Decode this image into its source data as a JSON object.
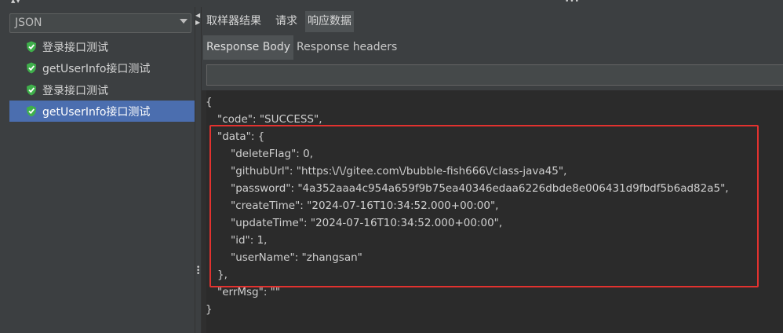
{
  "left_panel": {
    "renderer_select_value": "JSON",
    "results": [
      {
        "label": "登录接口测试",
        "status": "success"
      },
      {
        "label": "getUserInfo接口测试",
        "status": "success"
      },
      {
        "label": "登录接口测试",
        "status": "success"
      },
      {
        "label": "getUserInfo接口测试",
        "status": "success",
        "selected": true
      }
    ]
  },
  "tabs": [
    "取样器结果",
    "请求",
    "响应数据"
  ],
  "active_tab": "响应数据",
  "subtabs": [
    "Response Body",
    "Response headers"
  ],
  "active_subtab": "Response Body",
  "search_value": "",
  "json_lines": [
    "{",
    "\"code\": \"SUCCESS\",",
    "\"data\": {",
    "\"deleteFlag\": 0,",
    "\"githubUrl\": \"https:\\/\\/gitee.com\\/bubble-fish666\\/class-java45\",",
    "\"password\": \"4a352aaa4c954a659f9b75ea40346edaa6226dbde8e006431d9fbdf5b6ad82a5\",",
    "\"createTime\": \"2024-07-16T10:34:52.000+00:00\",",
    "\"updateTime\": \"2024-07-16T10:34:52.000+00:00\",",
    "\"id\": 1,",
    "\"userName\": \"zhangsan\"",
    "},",
    "\"errMsg\": \"\"",
    "}"
  ],
  "colors": {
    "selection": "#4b6eaf",
    "success_icon": "#3fb04b",
    "highlight_border": "#e2322f"
  }
}
